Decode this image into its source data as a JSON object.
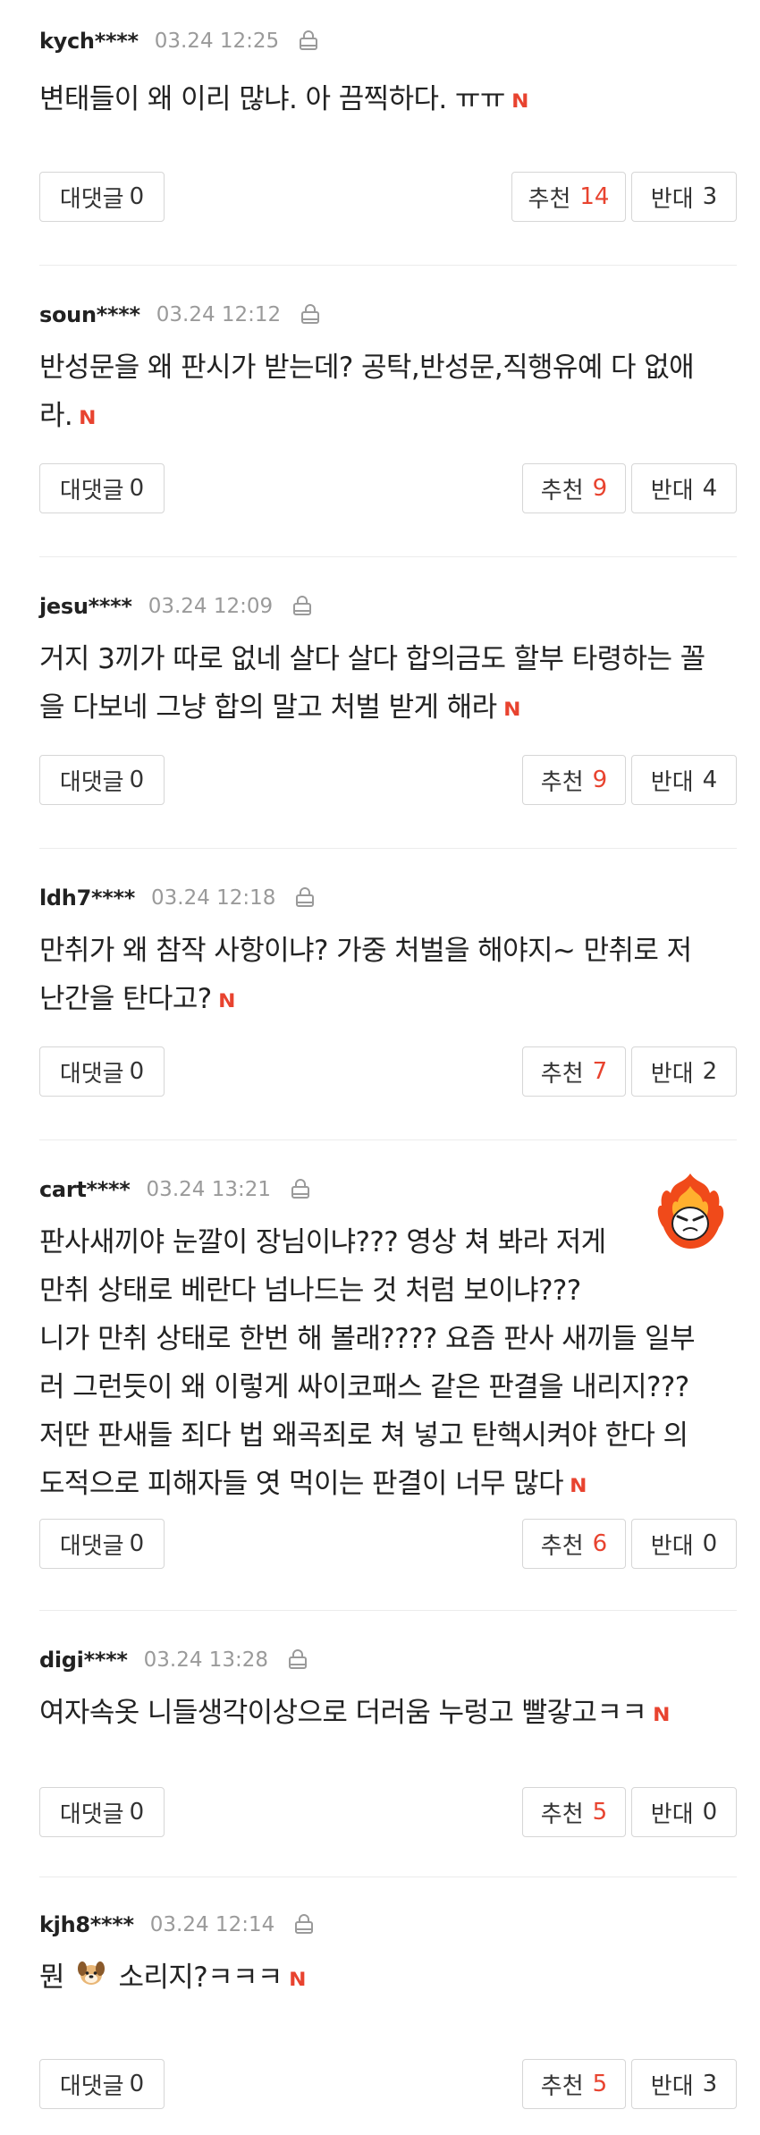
{
  "comments": [
    {
      "user": "kych****",
      "date": "03.24 12:25",
      "lines": [
        "변태들이 왜 이리 많냐. 아 끔찍하다. ㅠㅠ"
      ],
      "reply_label": "대댓글",
      "reply_count": "0",
      "up_label": "추천",
      "up_count": "14",
      "down_label": "반대",
      "down_count": "3"
    },
    {
      "user": "soun****",
      "date": "03.24 12:12",
      "lines": [
        "반성문을 왜 판시가 받는데? 공탁,반성문,직행유예 다 없애",
        "라."
      ],
      "reply_label": "대댓글",
      "reply_count": "0",
      "up_label": "추천",
      "up_count": "9",
      "down_label": "반대",
      "down_count": "4"
    },
    {
      "user": "jesu****",
      "date": "03.24 12:09",
      "lines": [
        "거지 3끼가 따로 없네 살다 살다 합의금도 할부 타령하는 꼴",
        "을 다보네 그냥 합의 말고 처벌 받게 해라"
      ],
      "reply_label": "대댓글",
      "reply_count": "0",
      "up_label": "추천",
      "up_count": "9",
      "down_label": "반대",
      "down_count": "4"
    },
    {
      "user": "ldh7****",
      "date": "03.24 12:18",
      "lines": [
        "만취가 왜 참작 사항이냐? 가중 처벌을 해야지~ 만취로 저",
        "난간을 탄다고?"
      ],
      "reply_label": "대댓글",
      "reply_count": "0",
      "up_label": "추천",
      "up_count": "7",
      "down_label": "반대",
      "down_count": "2"
    },
    {
      "user": "cart****",
      "date": "03.24 13:21",
      "lines": [
        "판사새끼야 눈깔이 장님이냐??? 영상 쳐 봐라 저게",
        "만취 상태로 베란다 넘나드는 것 처럼 보이냐???",
        "니가 만취 상태로 한번 해 볼래???? 요즘 판사 새끼들 일부",
        "러 그런듯이 왜 이렇게 싸이코패스 같은 판결을 내리지???",
        "저딴 판새들 죄다 법 왜곡죄로 쳐 넣고 탄핵시켜야 한다 의",
        "도적으로 피해자들 엿 먹이는 판결이 너무 많다"
      ],
      "reply_label": "대댓글",
      "reply_count": "0",
      "up_label": "추천",
      "up_count": "6",
      "down_label": "반대",
      "down_count": "0"
    },
    {
      "user": "digi****",
      "date": "03.24 13:28",
      "lines": [
        "여자속옷 니들생각이상으로 더러움 누렁고 빨갛고ㅋㅋ"
      ],
      "reply_label": "대댓글",
      "reply_count": "0",
      "up_label": "추천",
      "up_count": "5",
      "down_label": "반대",
      "down_count": "0"
    },
    {
      "user": "kjh8****",
      "date": "03.24 12:14",
      "lines_pre": "뭔",
      "lines_post": "소리지?ㅋㅋㅋ",
      "reply_label": "대댓글",
      "reply_count": "0",
      "up_label": "추천",
      "up_count": "5",
      "down_label": "반대",
      "down_count": "3"
    }
  ],
  "new_badge": "N",
  "colors": {
    "accent": "#e8432f",
    "meta": "#9a9a9a",
    "border": "#d6d6d6"
  }
}
